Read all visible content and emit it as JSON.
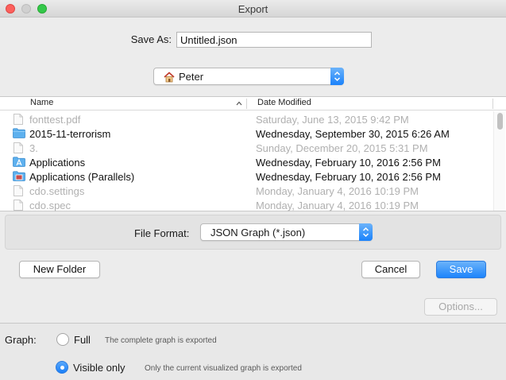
{
  "window": {
    "title": "Export"
  },
  "save_as": {
    "label": "Save As:",
    "value": "Untitled.json"
  },
  "location": {
    "label": "Peter",
    "icon": "home-icon"
  },
  "file_browser": {
    "columns": {
      "name": "Name",
      "date": "Date Modified"
    },
    "rows": [
      {
        "name": "fonttest.pdf",
        "date": "Saturday, June 13, 2015 9:42 PM",
        "icon": "document-icon",
        "enabled": false
      },
      {
        "name": "2015-11-terrorism",
        "date": "Wednesday, September 30, 2015 6:26 AM",
        "icon": "folder-icon",
        "enabled": true
      },
      {
        "name": "3.",
        "date": "Sunday, December 20, 2015 5:31 PM",
        "icon": "document-icon",
        "enabled": false
      },
      {
        "name": "Applications",
        "date": "Wednesday, February 10, 2016 2:56 PM",
        "icon": "applications-folder-icon",
        "enabled": true
      },
      {
        "name": "Applications (Parallels)",
        "date": "Wednesday, February 10, 2016 2:56 PM",
        "icon": "parallels-folder-icon",
        "enabled": true
      },
      {
        "name": "cdo.settings",
        "date": "Monday, January 4, 2016 10:19 PM",
        "icon": "document-icon",
        "enabled": false
      },
      {
        "name": "cdo.spec",
        "date": "Monday, January 4, 2016 10:19 PM",
        "icon": "document-icon",
        "enabled": false
      }
    ]
  },
  "file_format": {
    "label": "File Format:",
    "value": "JSON Graph (*.json)"
  },
  "buttons": {
    "new_folder": "New Folder",
    "cancel": "Cancel",
    "save": "Save",
    "options": "Options..."
  },
  "graph_options": {
    "label": "Graph:",
    "full": {
      "label": "Full",
      "description": "The complete graph is exported",
      "selected": false
    },
    "visible_only": {
      "label": "Visible only",
      "description": "Only the current visualized graph is exported",
      "selected": true
    }
  },
  "colors": {
    "accent": "#1d84fb",
    "close": "#fc605c",
    "maximize": "#34c84a",
    "folder": "#5db0ee"
  }
}
